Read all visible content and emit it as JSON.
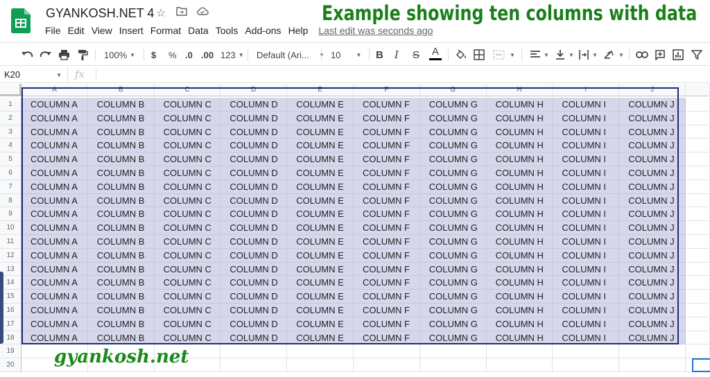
{
  "app": {
    "doc_title": "GYANKOSH.NET 4",
    "last_edit": "Last edit was seconds ago",
    "overlay_title": "Example showing ten columns with data",
    "watermark": "gyankosh.net",
    "brand_color": "#0f9d58",
    "overlay_color": "#1a7f1a"
  },
  "menu": [
    "File",
    "Edit",
    "View",
    "Insert",
    "Format",
    "Data",
    "Tools",
    "Add-ons",
    "Help"
  ],
  "toolbar": {
    "zoom": "100%",
    "currency": "$",
    "percent": "%",
    "decrease_decimal": ".0",
    "increase_decimal": ".00",
    "more_formats": "123",
    "font": "Default (Ari...",
    "font_size": "10",
    "bold": "B",
    "italic": "I",
    "strike": "S",
    "text_color": "A"
  },
  "formula_bar": {
    "cell_ref": "K20",
    "fx": "fx"
  },
  "columns": [
    "A",
    "B",
    "C",
    "D",
    "E",
    "F",
    "G",
    "H",
    "I",
    "J"
  ],
  "cell_text_prefix": "COLUMN",
  "rows": [
    "1",
    "2",
    "3",
    "4",
    "5",
    "6",
    "7",
    "8",
    "9",
    "10",
    "11",
    "12",
    "13",
    "14",
    "15",
    "16",
    "17",
    "18",
    "19",
    "20"
  ],
  "data_row_count": 18,
  "selection": {
    "range_color": "#d7d7ec",
    "border_color": "#1f2a7a",
    "active_cell": "K20"
  }
}
